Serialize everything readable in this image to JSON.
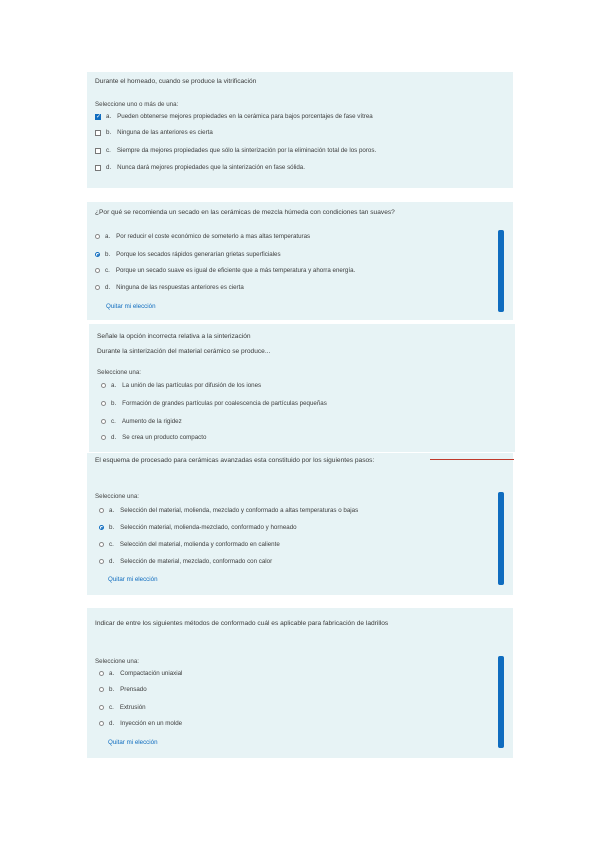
{
  "q1": {
    "question": "Durante el horneado, cuando se produce la vitrificación",
    "instruction": "Seleccione uno o más de una:",
    "options": [
      {
        "letter": "a.",
        "text": "Pueden obtenerse mejores propiedades en la cerámica para bajos porcentajes de fase vítrea",
        "checked": true
      },
      {
        "letter": "b.",
        "text": "Ninguna de las anteriores es cierta",
        "checked": false
      },
      {
        "letter": "c.",
        "text": "Siempre da mejores propiedades que sólo la sinterización por la eliminación total de los poros.",
        "checked": false
      },
      {
        "letter": "d.",
        "text": "Nunca dará mejores propiedades que la sinterización en fase sólida.",
        "checked": false
      }
    ]
  },
  "q2": {
    "question": "¿Por qué se recomienda un secado en las cerámicas de mezcla húmeda con condiciones tan suaves?",
    "options": [
      {
        "letter": "a.",
        "text": "Por reducir el coste económico de someterlo a mas altas temperaturas",
        "checked": false
      },
      {
        "letter": "b.",
        "text": "Porque los secados rápidos generarían grietas superficiales",
        "checked": true
      },
      {
        "letter": "c.",
        "text": "Porque un secado suave es igual de eficiente que a más temperatura y ahorra energía.",
        "checked": false
      },
      {
        "letter": "d.",
        "text": "Ninguna de las respuestas anteriores es cierta",
        "checked": false
      }
    ],
    "clear_label": "Quitar mi elección"
  },
  "q3": {
    "question": "Señale la opción incorrecta relativa a la sinterización",
    "subtitle": "Durante la sinterización del material cerámico se produce...",
    "instruction": "Seleccione una:",
    "options": [
      {
        "letter": "a.",
        "text": "La unión de las partículas por difusión de los iones",
        "checked": false
      },
      {
        "letter": "b.",
        "text": "Formación de grandes partículas por coalescencia de partículas pequeñas",
        "checked": false
      },
      {
        "letter": "c.",
        "text": "Aumento de la rigidez",
        "checked": false
      },
      {
        "letter": "d.",
        "text": "Se crea un producto compacto",
        "checked": false
      }
    ]
  },
  "q4": {
    "question": "El esquema de procesado para cerámicas avanzadas esta constituido por los siguientes pasos:",
    "instruction": "Seleccione una:",
    "options": [
      {
        "letter": "a.",
        "text": "Selección del material, molienda, mezclado y conformado a altas temperaturas o bajas",
        "checked": false
      },
      {
        "letter": "b.",
        "text": "Selección material, molienda-mezclado, conformado y horneado",
        "checked": true
      },
      {
        "letter": "c.",
        "text": "Selección del material, molienda y conformado en caliente",
        "checked": false
      },
      {
        "letter": "d.",
        "text": "Selección de material, mezclado, conformado con calor",
        "checked": false
      }
    ],
    "clear_label": "Quitar mi elección"
  },
  "q5": {
    "question": "Indicar de entre los siguientes métodos de conformado cuál es aplicable para fabricación de ladrillos",
    "instruction": "Seleccione una:",
    "options": [
      {
        "letter": "a.",
        "text": "Compactación uniaxial",
        "checked": false
      },
      {
        "letter": "b.",
        "text": "Prensado",
        "checked": false
      },
      {
        "letter": "c.",
        "text": "Extrusión",
        "checked": false
      },
      {
        "letter": "d.",
        "text": "Inyección en un molde",
        "checked": false
      }
    ],
    "clear_label": "Quitar mi elección"
  },
  "colors": {
    "card_bg": "#e7f3f5",
    "accent": "#0f6cbf",
    "divider": "#c0392b"
  }
}
